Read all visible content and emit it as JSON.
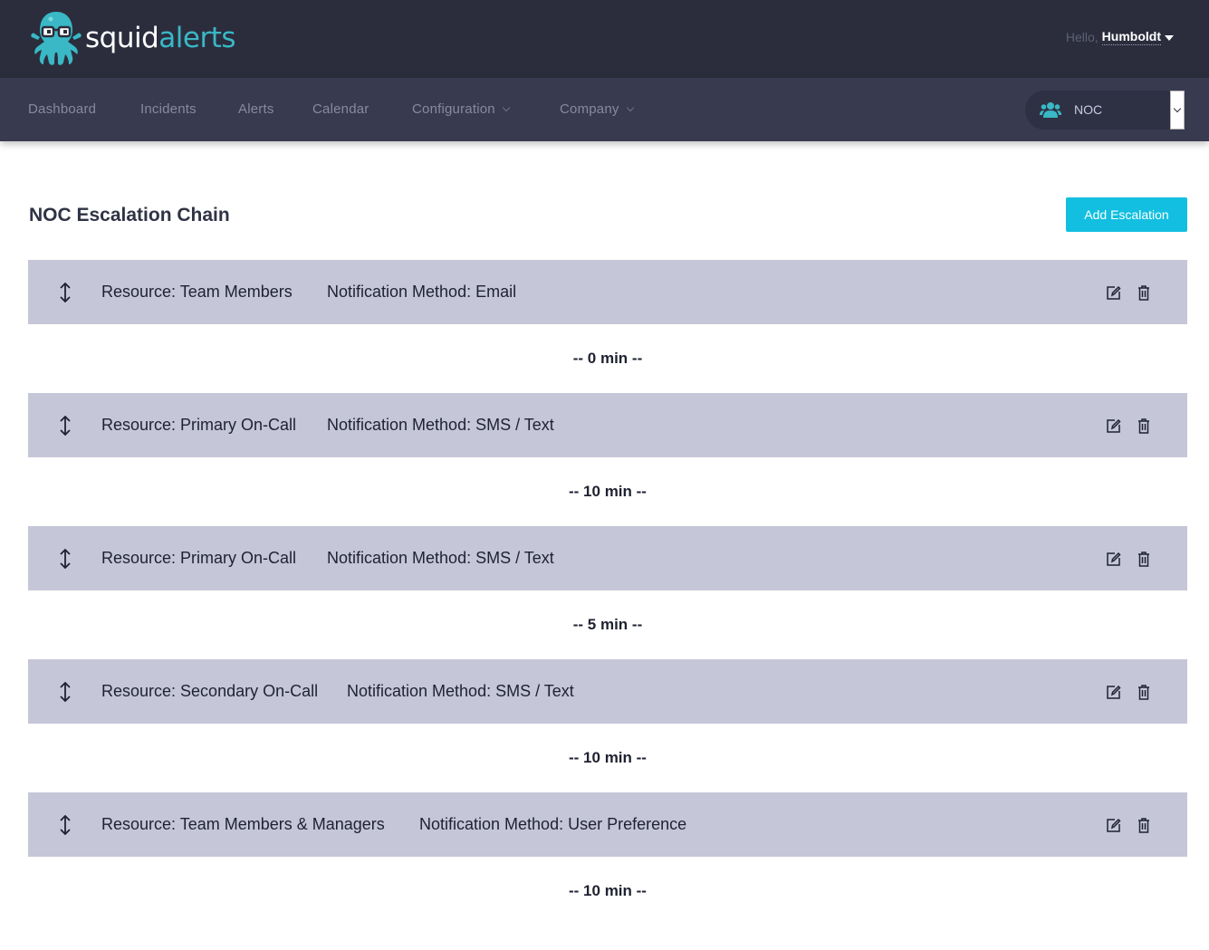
{
  "brand": {
    "name_part1": "squid",
    "name_part2": "alerts",
    "accent": "#3ab8c5"
  },
  "header": {
    "greeting": "Hello,",
    "user": "Humboldt"
  },
  "nav": {
    "items": [
      {
        "label": "Dashboard"
      },
      {
        "label": "Incidents"
      },
      {
        "label": "Alerts"
      },
      {
        "label": "Calendar"
      },
      {
        "label": "Configuration"
      },
      {
        "label": "Company"
      }
    ],
    "team_select": {
      "value": "NOC"
    }
  },
  "page": {
    "title": "NOC Escalation Chain",
    "add_button": "Add Escalation"
  },
  "escalations": [
    {
      "resource": "Resource: Team Members",
      "method": "Notification Method: Email",
      "delay": "-- 0 min --"
    },
    {
      "resource": "Resource: Primary On-Call",
      "method": "Notification Method: SMS / Text",
      "delay": "-- 10 min --"
    },
    {
      "resource": "Resource: Primary On-Call",
      "method": "Notification Method: SMS / Text",
      "delay": "-- 5 min --"
    },
    {
      "resource": "Resource: Secondary On-Call",
      "method": "Notification Method: SMS / Text",
      "delay": "-- 10 min --"
    },
    {
      "resource": "Resource: Team Members & Managers",
      "method": "Notification Method: User Preference",
      "delay": "-- 10 min --"
    }
  ],
  "colors": {
    "topbar": "#2b2d3d",
    "navbar": "#383b4f",
    "row": "#c5c6d8",
    "button": "#12bfe0"
  }
}
